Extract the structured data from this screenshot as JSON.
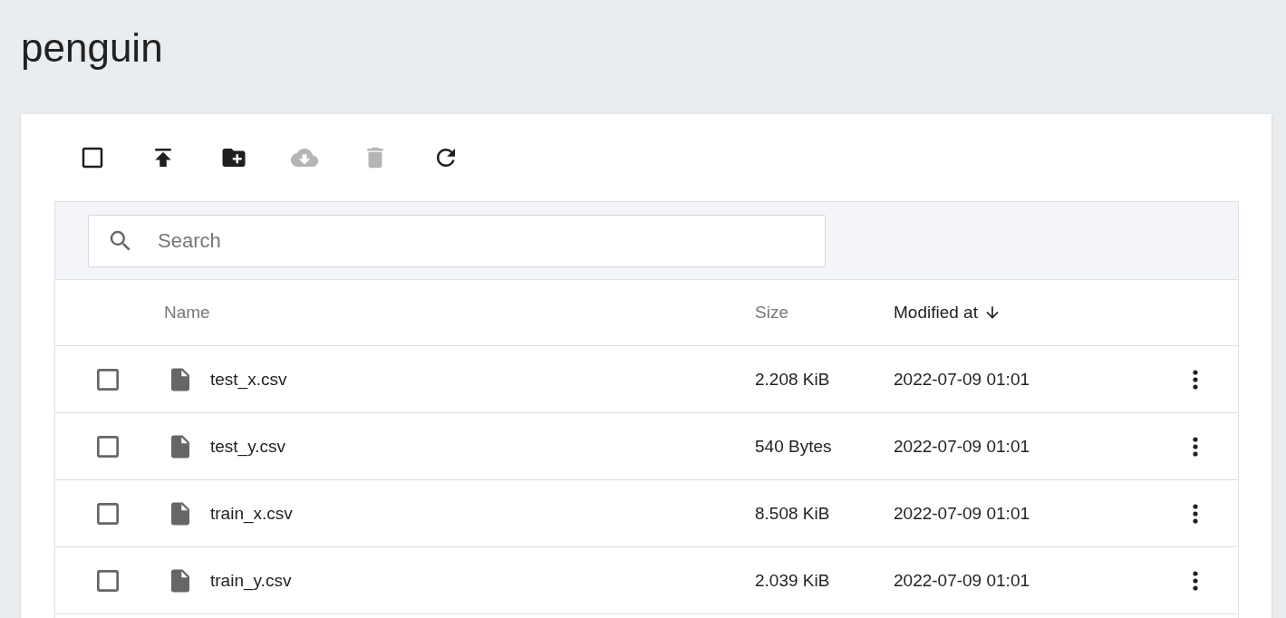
{
  "title": "penguin",
  "toolbar": [
    {
      "kind": "select-all",
      "checked": false,
      "disabled": false
    },
    {
      "kind": "upload",
      "disabled": false
    },
    {
      "kind": "new-folder",
      "disabled": false
    },
    {
      "kind": "download",
      "disabled": true
    },
    {
      "kind": "delete",
      "disabled": true
    },
    {
      "kind": "refresh",
      "disabled": false
    }
  ],
  "search": {
    "placeholder": "Search"
  },
  "columns": [
    {
      "label": "Name",
      "sorted": false
    },
    {
      "label": "Size",
      "sorted": false
    },
    {
      "label": "Modified at",
      "sorted": true
    }
  ],
  "rows": [
    {
      "name": "test_x.csv",
      "size": "2.208 KiB",
      "modified": "2022-07-09 01:01",
      "checked": false
    },
    {
      "name": "test_y.csv",
      "size": "540 Bytes",
      "modified": "2022-07-09 01:01",
      "checked": false
    },
    {
      "name": "train_x.csv",
      "size": "8.508 KiB",
      "modified": "2022-07-09 01:01",
      "checked": false
    },
    {
      "name": "train_y.csv",
      "size": "2.039 KiB",
      "modified": "2022-07-09 01:01",
      "checked": false
    }
  ]
}
